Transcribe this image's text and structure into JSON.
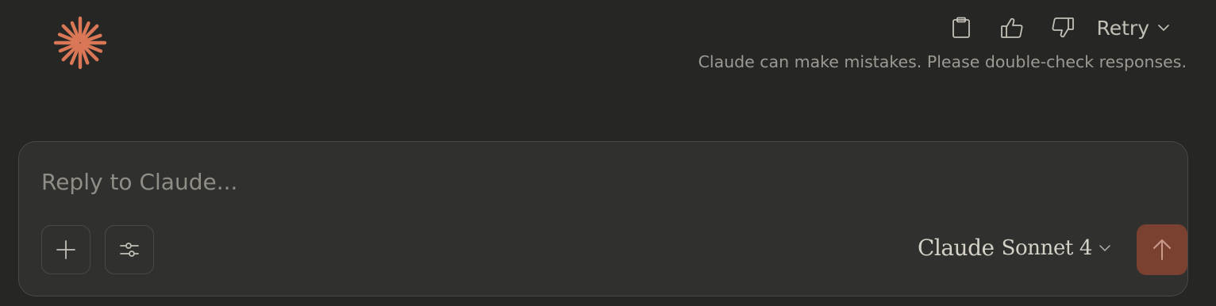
{
  "colors": {
    "background": "#262624",
    "composer_bg": "#30302e",
    "accent_logo": "#d97757",
    "send_button_bg": "#7a4131",
    "muted_text": "#9c9a92"
  },
  "header": {
    "logo_icon": "claude-starburst-icon",
    "actions": {
      "copy_icon": "clipboard-icon",
      "thumbs_up_icon": "thumbs-up-icon",
      "thumbs_down_icon": "thumbs-down-icon",
      "retry_label": "Retry",
      "retry_chevron_icon": "chevron-down-icon"
    },
    "disclaimer": "Claude can make mistakes. Please double-check responses."
  },
  "composer": {
    "placeholder": "Reply to Claude...",
    "value": "",
    "add_icon": "plus-icon",
    "tools_icon": "sliders-icon",
    "model": {
      "brand": "Claude",
      "name": "Sonnet 4"
    },
    "send_icon": "arrow-up-icon"
  }
}
